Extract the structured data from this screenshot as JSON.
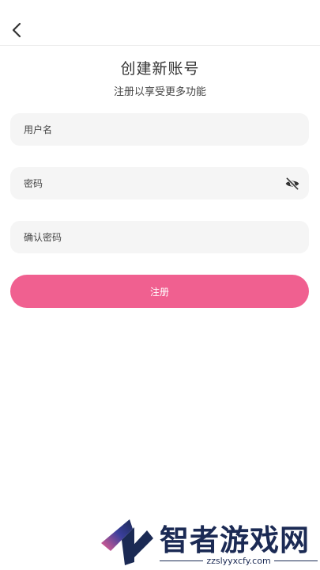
{
  "header": {
    "back_icon": "chevron-left-icon",
    "title": "创建新账号",
    "subtitle": "注册以享受更多功能"
  },
  "form": {
    "username_placeholder": "用户名",
    "password_placeholder": "密码",
    "password_visibility_icon": "eye-off-icon",
    "confirm_placeholder": "确认密码",
    "submit_label": "注册"
  },
  "watermark": {
    "name": "智者游戏网",
    "url": "zzslyyxcfy.com"
  },
  "colors": {
    "accent": "#f06090",
    "field_bg": "#f5f5f5",
    "watermark_text": "#1b2a54"
  }
}
